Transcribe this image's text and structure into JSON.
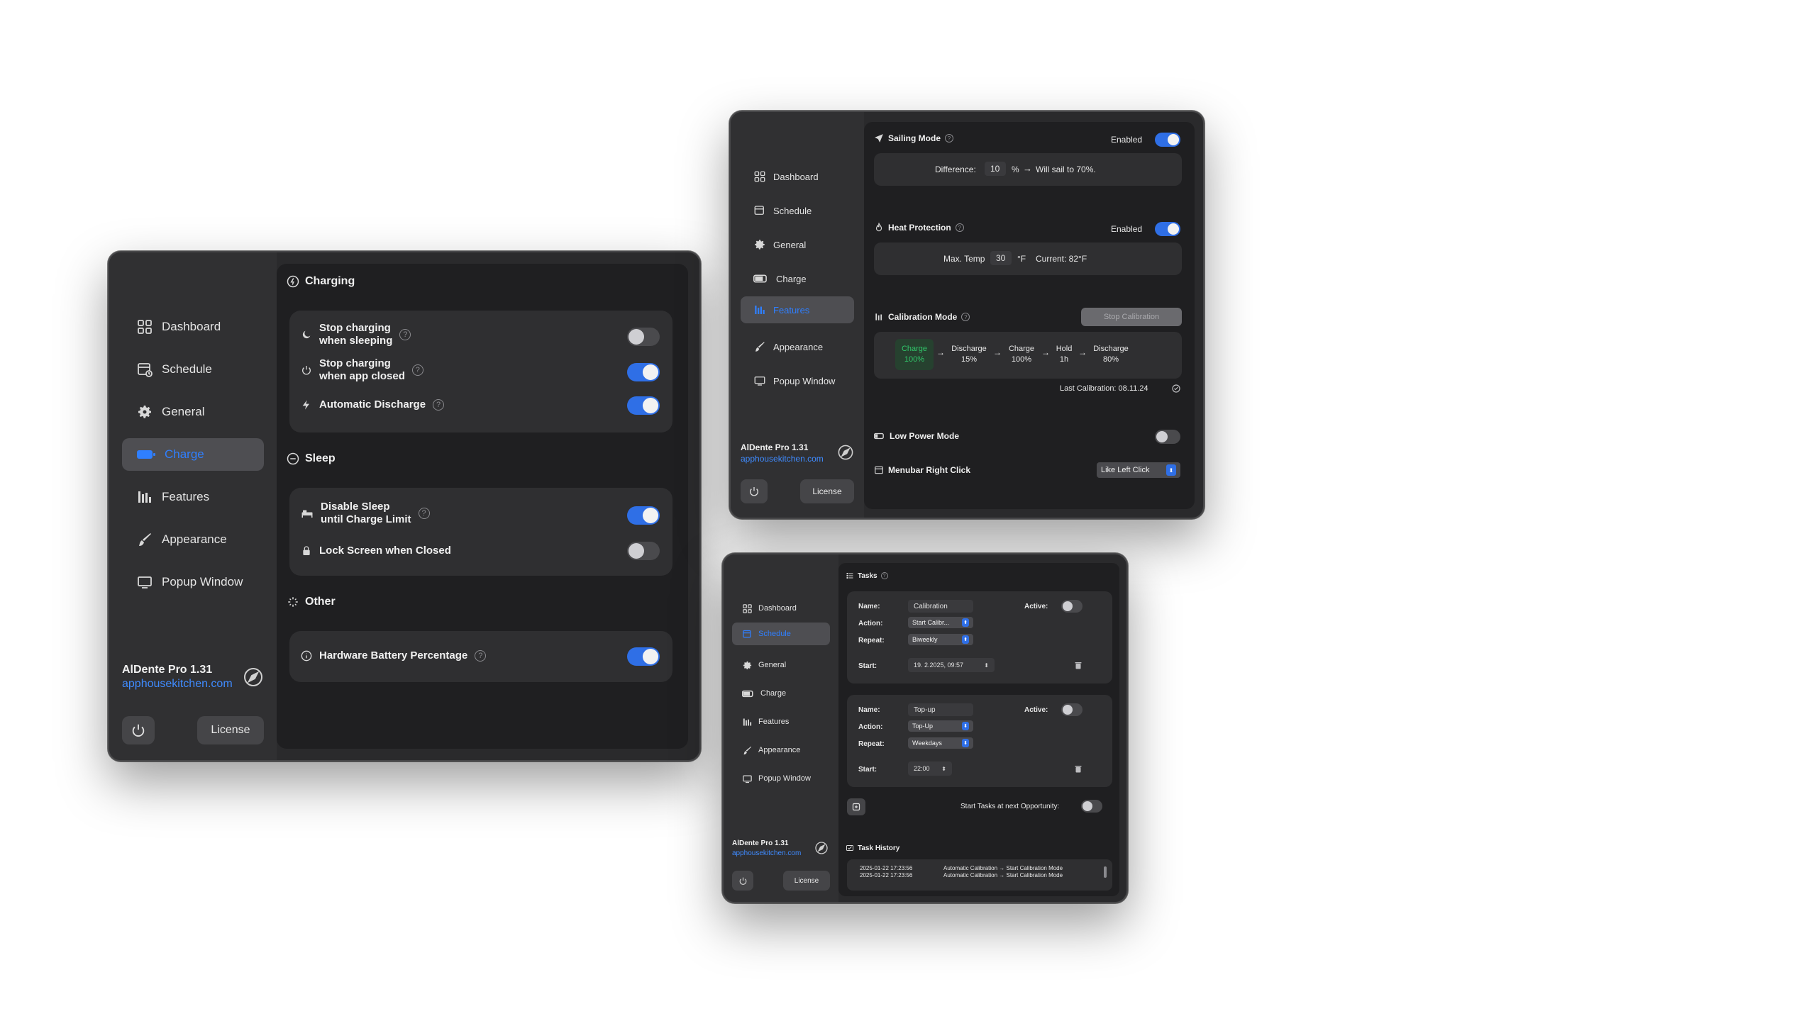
{
  "colors": {
    "accent": "#2f6fe6",
    "link": "#3f8bff",
    "active_text": "#2f7fff",
    "green": "#31c56a",
    "close": "#ff5f57"
  },
  "brand": {
    "name": "AlDente Pro 1.31",
    "link": "apphousekitchen.com",
    "license": "License"
  },
  "nav": {
    "dashboard": "Dashboard",
    "schedule": "Schedule",
    "general": "General",
    "charge": "Charge",
    "features": "Features",
    "appearance": "Appearance",
    "popup": "Popup Window"
  },
  "icons": [
    "dashboard-icon",
    "schedule-icon",
    "gear-icon",
    "battery-icon",
    "features-icon",
    "brush-icon",
    "popup-window-icon",
    "power-icon",
    "moon-icon",
    "plus-icon",
    "trash-icon",
    "help-icon",
    "bolt-icon",
    "lock-icon",
    "bed-icon",
    "info-icon"
  ],
  "win1": {
    "charging_title": "Charging",
    "stop_sleep_1": "Stop charging",
    "stop_sleep_2": "when sleeping",
    "stop_closed_1": "Stop charging",
    "stop_closed_2": "when app closed",
    "auto_discharge": "Automatic Discharge",
    "sleep_title": "Sleep",
    "disable_sleep_1": "Disable Sleep",
    "disable_sleep_2": "until Charge Limit",
    "lock_screen": "Lock Screen when Closed",
    "other_title": "Other",
    "hw_battery": "Hardware Battery Percentage",
    "toggles": {
      "stop_sleep": false,
      "stop_closed": true,
      "auto_discharge": true,
      "disable_sleep": true,
      "lock_screen": false,
      "hw_battery": true
    }
  },
  "win2": {
    "sailing_title": "Sailing Mode",
    "enabled": "Enabled",
    "difference_label": "Difference:",
    "difference_value": "10",
    "percent": "%",
    "arrow": "→",
    "sail_result": "Will sail to 70%.",
    "heat_title": "Heat Protection",
    "max_temp_label": "Max. Temp",
    "max_temp_value": "30",
    "unit_f": "°F",
    "current": "Current: 82°F",
    "calibration_title": "Calibration Mode",
    "stop_calibration": "Stop Calibration",
    "steps": [
      {
        "line1": "Charge",
        "line2": "100%"
      },
      {
        "line1": "Discharge",
        "line2": "15%"
      },
      {
        "line1": "Charge",
        "line2": "100%"
      },
      {
        "line1": "Hold",
        "line2": "1h"
      },
      {
        "line1": "Discharge",
        "line2": "80%"
      }
    ],
    "last_calibration": "Last Calibration: 08.11.24",
    "low_power": "Low Power Mode",
    "menubar_right": "Menubar Right Click",
    "menubar_value": "Like Left Click"
  },
  "win3": {
    "tasks_title": "Tasks",
    "name_label": "Name:",
    "action_label": "Action:",
    "repeat_label": "Repeat:",
    "start_label": "Start:",
    "active_label": "Active:",
    "task1": {
      "name": "Calibration",
      "action": "Start Calibr...",
      "repeat": "Biweekly",
      "start": "19.  2.2025, 09:57"
    },
    "task2": {
      "name": "Top-up",
      "action": "Top-Up",
      "repeat": "Weekdays",
      "start": "22:00"
    },
    "next_opportunity": "Start Tasks at next Opportunity:",
    "history_title": "Task History",
    "history": [
      {
        "time": "2025-01-22 17:23:56",
        "text": "Automatic Calibration → Start Calibration Mode"
      },
      {
        "time": "2025-01-22 17:23:56",
        "text": "Automatic Calibration → Start Calibration Mode"
      }
    ]
  }
}
